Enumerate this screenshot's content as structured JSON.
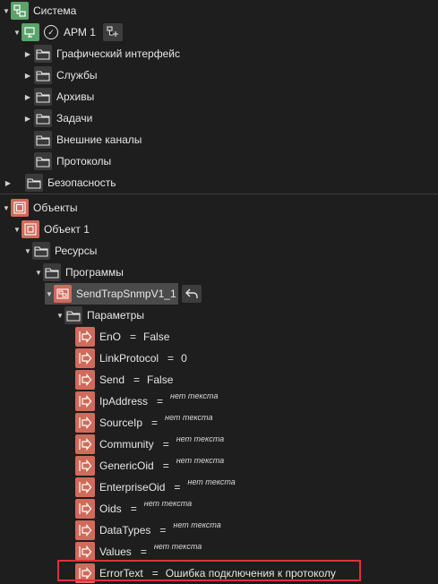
{
  "tree": {
    "system": {
      "label": "Система"
    },
    "arm": {
      "label": "АРМ 1"
    },
    "arm_children": [
      {
        "label": "Графический интерфейс",
        "expandable": true
      },
      {
        "label": "Службы",
        "expandable": true
      },
      {
        "label": "Архивы",
        "expandable": true
      },
      {
        "label": "Задачи",
        "expandable": true
      },
      {
        "label": "Внешние каналы",
        "expandable": false
      },
      {
        "label": "Протоколы",
        "expandable": false
      }
    ],
    "security": {
      "label": "Безопасность"
    },
    "objects": {
      "label": "Объекты"
    },
    "object1": {
      "label": "Объект 1"
    },
    "resources": {
      "label": "Ресурсы"
    },
    "programs": {
      "label": "Программы"
    },
    "program": {
      "label": "SendTrapSnmpV1_1"
    },
    "parameters": {
      "label": "Параметры"
    },
    "param_rows": [
      {
        "name": "EnO",
        "eq": "=",
        "value": "False",
        "empty": false
      },
      {
        "name": "LinkProtocol",
        "eq": "=",
        "value": "0",
        "empty": false
      },
      {
        "name": "Send",
        "eq": "=",
        "value": "False",
        "empty": false
      },
      {
        "name": "IpAddress",
        "eq": "=",
        "value": "нет текста",
        "empty": true
      },
      {
        "name": "SourceIp",
        "eq": "=",
        "value": "нет текста",
        "empty": true
      },
      {
        "name": "Community",
        "eq": "=",
        "value": "нет текста",
        "empty": true
      },
      {
        "name": "GenericOid",
        "eq": "=",
        "value": "нет текста",
        "empty": true
      },
      {
        "name": "EnterpriseOid",
        "eq": "=",
        "value": "нет текста",
        "empty": true
      },
      {
        "name": "Oids",
        "eq": "=",
        "value": "нет текста",
        "empty": true
      },
      {
        "name": "DataTypes",
        "eq": "=",
        "value": "нет текста",
        "empty": true
      },
      {
        "name": "Values",
        "eq": "=",
        "value": "нет текста",
        "empty": true
      },
      {
        "name": "ErrorText",
        "eq": "=",
        "value": "Ошибка подключения к протоколу",
        "empty": false
      }
    ]
  },
  "colors": {
    "highlight": "#e0303a",
    "system_icon": "#5aa36a",
    "object_icon": "#d06a5a"
  },
  "icons": {
    "system": "system-node-icon",
    "folder": "folder-icon",
    "parameter": "input-parameter-icon",
    "back": "back-arrow-icon",
    "add": "add-child-icon"
  }
}
